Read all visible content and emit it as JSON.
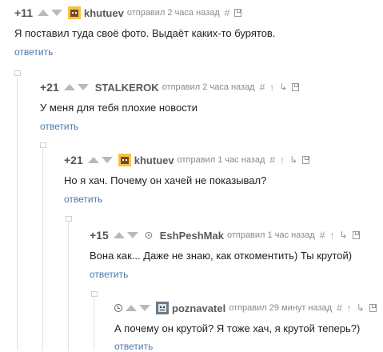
{
  "colors": {
    "reply_link": "#4b78a8",
    "arrows": "#b9b9b9",
    "meta": "#888888"
  },
  "comments": [
    {
      "rating": "+11",
      "username": "khutuev",
      "avatar_icon": "dog-avatar-icon",
      "posted": "отправил 2 часа назад",
      "text": "Я поставил туда своё фото. Выдаёт каких-то бурятов.",
      "reply": "ответить"
    },
    {
      "rating": "+21",
      "username": "STALKEROK",
      "posted": "отправил 2 часа назад",
      "text": "У меня для тебя плохие новости",
      "reply": "ответить"
    },
    {
      "rating": "+21",
      "username": "khutuev",
      "avatar_icon": "dog-avatar-icon",
      "posted": "отправил 1 час назад",
      "text": "Но я хач. Почему он хачей не показывал?",
      "reply": "ответить"
    },
    {
      "rating": "+15",
      "username": "EshPeshMak",
      "avatar_icon": "small-avatar-icon",
      "posted": "отправил 1 час назад",
      "text": "Вона как... Даже не знаю, как откоментить) Ты крутой)",
      "reply": "ответить"
    },
    {
      "rating": "",
      "username": "poznavatel",
      "avatar_icon": "robot-avatar-icon",
      "posted": "отправил 29 минут назад",
      "text": "А почему он крутой? Я тоже хач, я крутой теперь?)",
      "reply": "ответить"
    }
  ],
  "tool_glyphs": {
    "link": "#",
    "up_parent": "↑",
    "down_reply": "↳"
  }
}
